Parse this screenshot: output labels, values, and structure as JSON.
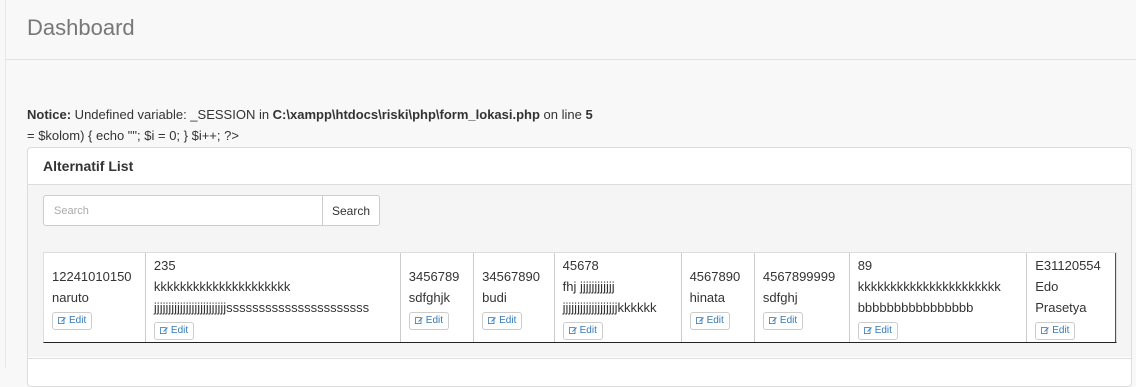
{
  "header": {
    "title": "Dashboard"
  },
  "notice": {
    "label": "Notice:",
    "message": " Undefined variable: _SESSION in ",
    "path": "C:\\xampp\\htdocs\\riski\\php\\form_lokasi.php",
    "on_line": " on line ",
    "line_no": "5"
  },
  "echo_line": "= $kolom) { echo \"\"; $i = 0; } $i++; ?>",
  "panel": {
    "title": "Alternatif List"
  },
  "search": {
    "placeholder": "Search",
    "button_label": "Search"
  },
  "edit_label": "Edit",
  "cells": [
    {
      "lines": [
        "12241010150",
        "naruto"
      ]
    },
    {
      "lines": [
        "235",
        "kkkkkkkkkkkkkkkkkkkkk",
        "jjjjjjjjjjjjjjjjjjjjjjjjjssssssssssssssssssssss"
      ]
    },
    {
      "lines": [
        "3456789",
        "sdfghjk"
      ]
    },
    {
      "lines": [
        "34567890",
        "budi"
      ]
    },
    {
      "lines": [
        "45678",
        "fhj jjjjjjjjjjjj",
        "jjjjjjjjjjjjjjjjjjjkkkkkk"
      ]
    },
    {
      "lines": [
        "4567890",
        "hinata"
      ]
    },
    {
      "lines": [
        "4567899999",
        "sdfghj"
      ]
    },
    {
      "lines": [
        "89",
        "kkkkkkkkkkkkkkkkkkkkkk",
        "bbbbbbbbbbbbbbbb"
      ]
    },
    {
      "lines": [
        "E31120554",
        "Edo",
        "Prasetya"
      ]
    }
  ],
  "icons": {
    "edit": "edit-icon"
  },
  "colors": {
    "link": "#337ab7",
    "header_text": "#777777"
  }
}
